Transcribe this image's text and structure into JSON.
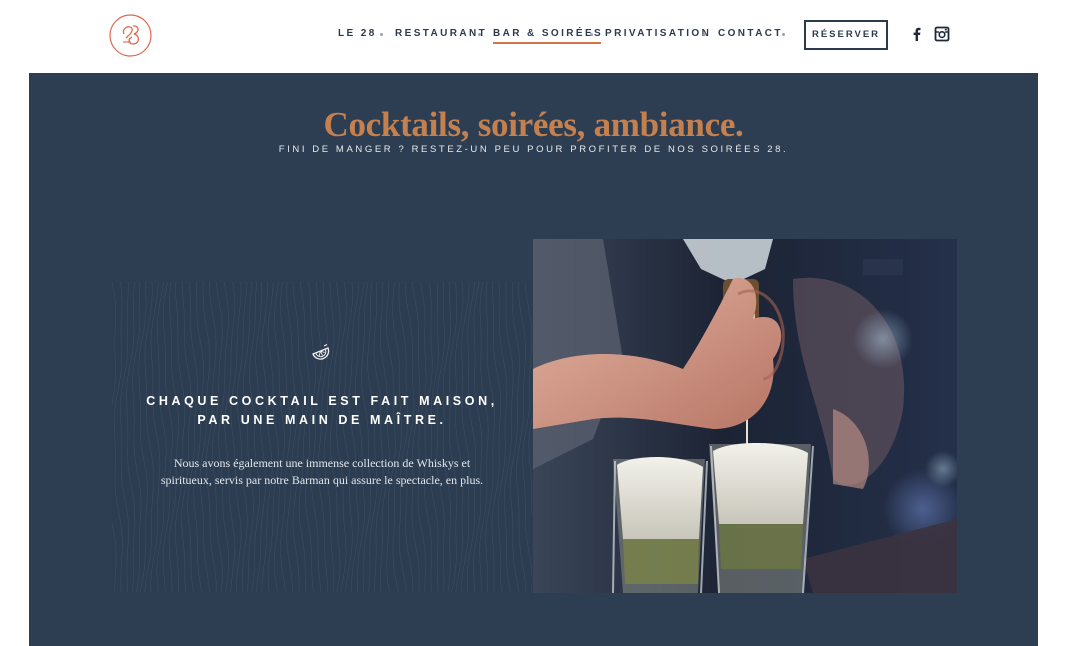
{
  "header": {
    "nav": [
      {
        "label": "LE 28"
      },
      {
        "label": "RESTAURANT"
      },
      {
        "label": "BAR & SOIRÉES",
        "active": true
      },
      {
        "label": "PRIVATISATION"
      },
      {
        "label": "CONTACT"
      }
    ],
    "reserve_label": "RÉSERVER",
    "social": [
      "facebook-icon",
      "instagram-icon"
    ]
  },
  "hero": {
    "title": "Cocktails, soirées, ambiance.",
    "subtitle": "FINI DE MANGER ? RESTEZ-UN PEU POUR PROFITER DE NOS SOIRÉES 28."
  },
  "feature": {
    "icon": "lime-slice-icon",
    "title_line1": "CHAQUE COCKTAIL EST FAIT MAISON,",
    "title_line2": "PAR UNE MAIN DE MAÎTRE.",
    "body_line1": "Nous avons également une immense collection de Whiskys et",
    "body_line2": "spiritueux, servis par notre Barman qui assure le spectacle, en plus."
  },
  "colors": {
    "accent": "#d4744b",
    "headline": "#c4804e",
    "background": "#2e3e52",
    "nav_text": "#2c3a4d"
  }
}
